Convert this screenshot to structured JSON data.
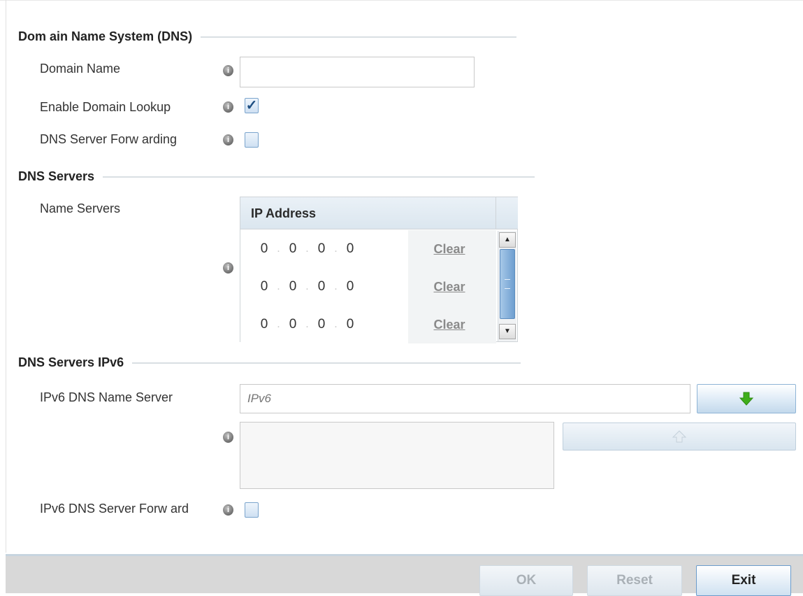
{
  "dns_section": {
    "title": "Dom ain Name System (DNS)",
    "domain_name_label": "Domain Name",
    "domain_name_value": "",
    "enable_domain_lookup_label": "Enable Domain Lookup",
    "enable_domain_lookup_checked": true,
    "dns_server_forwarding_label": "DNS Server Forw arding",
    "dns_server_forwarding_checked": false
  },
  "dns_servers": {
    "title": "DNS Servers",
    "name_servers_label": "Name Servers",
    "column_header": "IP Address",
    "clear_label": "Clear",
    "rows": [
      {
        "octets": [
          "0",
          "0",
          "0",
          "0"
        ]
      },
      {
        "octets": [
          "0",
          "0",
          "0",
          "0"
        ]
      },
      {
        "octets": [
          "0",
          "0",
          "0",
          "0"
        ]
      }
    ]
  },
  "dns_ipv6": {
    "title": "DNS Servers IPv6",
    "name_server_label": "IPv6 DNS Name Server",
    "name_server_placeholder": "IPv6",
    "server_forward_label": "IPv6 DNS Server Forw ard",
    "server_forward_checked": false
  },
  "footer": {
    "ok_label": "OK",
    "reset_label": "Reset",
    "exit_label": "Exit"
  },
  "icons": {
    "info": "info-icon",
    "add": "arrow-down-icon",
    "remove": "arrow-up-icon",
    "scroll_up": "triangle-up-icon",
    "scroll_down": "triangle-down-icon"
  },
  "colors": {
    "accent": "#6e9fd0",
    "add_arrow": "#3fae1b",
    "footer": "#d8d8d8"
  }
}
